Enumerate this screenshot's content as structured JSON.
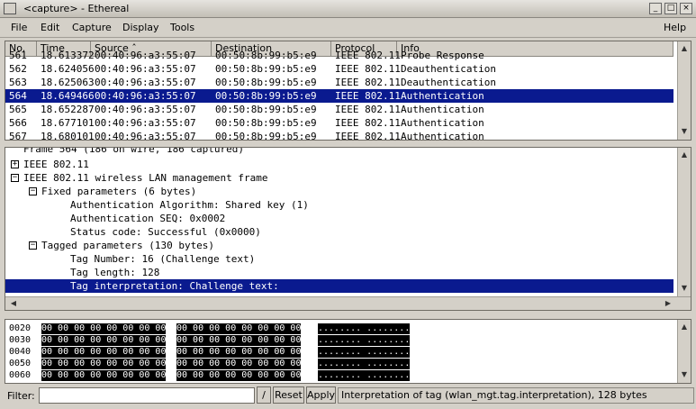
{
  "window": {
    "title": "<capture> - Ethereal",
    "minimize_glyph": "_",
    "maximize_glyph": "□",
    "close_glyph": "×"
  },
  "menu": {
    "file": "File",
    "edit": "Edit",
    "capture": "Capture",
    "display": "Display",
    "tools": "Tools",
    "help": "Help"
  },
  "packet_list": {
    "columns": [
      "No.",
      "Time",
      "Source ˆ",
      "Destination",
      "Protocol",
      "Info"
    ],
    "rows": [
      {
        "no": "561",
        "time": "18.613372",
        "src": "00:40:96:a3:55:07",
        "dst": "00:50:8b:99:b5:e9",
        "proto": "IEEE 802.11",
        "info": "Probe Response",
        "cut": "top"
      },
      {
        "no": "562",
        "time": "18.624056",
        "src": "00:40:96:a3:55:07",
        "dst": "00:50:8b:99:b5:e9",
        "proto": "IEEE 802.11",
        "info": "Deauthentication"
      },
      {
        "no": "563",
        "time": "18.625063",
        "src": "00:40:96:a3:55:07",
        "dst": "00:50:8b:99:b5:e9",
        "proto": "IEEE 802.11",
        "info": "Deauthentication"
      },
      {
        "no": "564",
        "time": "18.649466",
        "src": "00:40:96:a3:55:07",
        "dst": "00:50:8b:99:b5:e9",
        "proto": "IEEE 802.11",
        "info": "Authentication",
        "selected": true
      },
      {
        "no": "565",
        "time": "18.652287",
        "src": "00:40:96:a3:55:07",
        "dst": "00:50:8b:99:b5:e9",
        "proto": "IEEE 802.11",
        "info": "Authentication"
      },
      {
        "no": "566",
        "time": "18.677101",
        "src": "00:40:96:a3:55:07",
        "dst": "00:50:8b:99:b5:e9",
        "proto": "IEEE 802.11",
        "info": "Authentication"
      },
      {
        "no": "567",
        "time": "18.680101",
        "src": "00:40:96:a3:55:07",
        "dst": "00:50:8b:99:b5:e9",
        "proto": "IEEE 802.11",
        "info": "Authentication",
        "cut": "bottom"
      }
    ]
  },
  "detail_tree": {
    "items": [
      {
        "text": "Frame 564 (186 on wire, 186 captured)",
        "box": "⊞",
        "cut": "top"
      },
      {
        "text": "IEEE 802.11",
        "box": "+"
      },
      {
        "text": "IEEE 802.11 wireless LAN management frame",
        "box": "−"
      },
      {
        "text": "Fixed parameters (6 bytes)",
        "box": "−"
      },
      {
        "text": "Authentication Algorithm: Shared key (1)"
      },
      {
        "text": "Authentication SEQ: 0x0002"
      },
      {
        "text": "Status code: Successful (0x0000)"
      },
      {
        "text": "Tagged parameters (130 bytes)",
        "box": "−"
      },
      {
        "text": "Tag Number: 16 (Challenge text)"
      },
      {
        "text": "Tag length: 128"
      },
      {
        "text": "Tag interpretation: Challenge text:",
        "selected": true
      }
    ]
  },
  "hex_dump": {
    "rows": [
      {
        "offset": "0020",
        "bytes1": "00 00 00 00 00 00 00 00",
        "bytes2": "00 00 00 00 00 00 00 00",
        "ascii": "........ ........"
      },
      {
        "offset": "0030",
        "bytes1": "00 00 00 00 00 00 00 00",
        "bytes2": "00 00 00 00 00 00 00 00",
        "ascii": "........ ........"
      },
      {
        "offset": "0040",
        "bytes1": "00 00 00 00 00 00 00 00",
        "bytes2": "00 00 00 00 00 00 00 00",
        "ascii": "........ ........"
      },
      {
        "offset": "0050",
        "bytes1": "00 00 00 00 00 00 00 00",
        "bytes2": "00 00 00 00 00 00 00 00",
        "ascii": "........ ........"
      },
      {
        "offset": "0060",
        "bytes1": "00 00 00 00 00 00 00 00",
        "bytes2": "00 00 00 00 00 00 00 00",
        "ascii": "........ ........"
      }
    ]
  },
  "filter": {
    "label": "Filter:",
    "value": "",
    "edit_glyph": "/",
    "reset": "Reset",
    "apply": "Apply"
  },
  "status": "Interpretation of tag (wlan_mgt.tag.interpretation), 128 bytes",
  "colors": {
    "selection": "#0a1a8f",
    "background": "#d4d0c8"
  },
  "icons": {
    "scroll_up": "▲",
    "scroll_down": "▼",
    "scroll_left": "◀",
    "scroll_right": "▶"
  }
}
